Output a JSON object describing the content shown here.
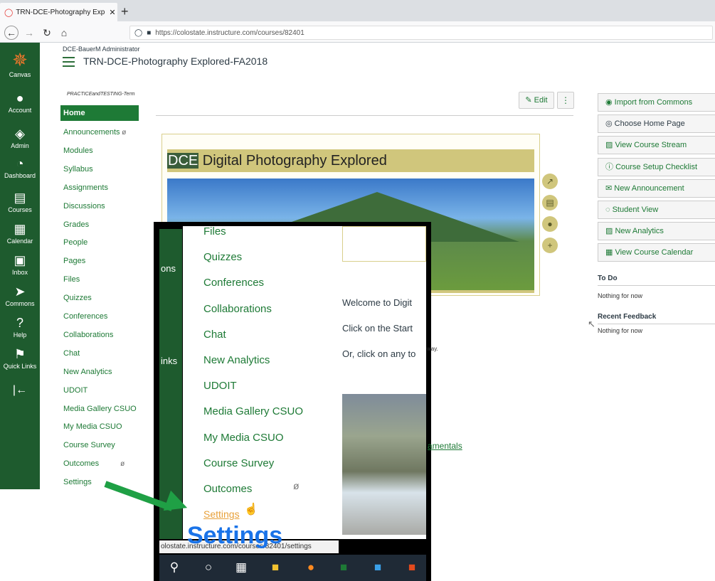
{
  "browser": {
    "tab_title": "TRN-DCE-Photography Exploré",
    "tab_close": "✕",
    "new_tab": "+",
    "url": "https://colostate.instructure.com/courses/82401"
  },
  "global_nav": {
    "items": [
      {
        "label": "Canvas",
        "icon": "canvas-logo-icon"
      },
      {
        "label": "Account",
        "icon": "account-icon"
      },
      {
        "label": "Admin",
        "icon": "admin-icon"
      },
      {
        "label": "Dashboard",
        "icon": "dashboard-icon"
      },
      {
        "label": "Courses",
        "icon": "courses-icon"
      },
      {
        "label": "Calendar",
        "icon": "calendar-icon"
      },
      {
        "label": "Inbox",
        "icon": "inbox-icon"
      },
      {
        "label": "Commons",
        "icon": "commons-icon"
      },
      {
        "label": "Help",
        "icon": "help-icon"
      },
      {
        "label": "Quick Links",
        "icon": "quick-links-icon"
      }
    ],
    "collapse_glyph": "|←"
  },
  "header": {
    "admin_crumb": "DCE-BauerM Administrator",
    "course_title": "TRN-DCE-Photography Explored-FA2018",
    "term": "PRACTICEandTESTING-Term"
  },
  "course_nav": {
    "items": [
      "Home",
      "Announcements",
      "Modules",
      "Syllabus",
      "Assignments",
      "Discussions",
      "Grades",
      "People",
      "Pages",
      "Files",
      "Quizzes",
      "Conferences",
      "Collaborations",
      "Chat",
      "New Analytics",
      "UDOIT",
      "Media Gallery CSUO",
      "My Media CSUO",
      "Course Survey",
      "Outcomes",
      "Settings"
    ]
  },
  "main": {
    "edit_label": "✎ Edit",
    "kebab_label": "⋮",
    "banner_prefix": "DCE",
    "banner_title": " Digital Photography Explored"
  },
  "sidebar": {
    "buttons": [
      "Import from Commons",
      "Choose Home Page",
      "View Course Stream",
      "Course Setup Checklist",
      "New Announcement",
      "Student View",
      "New Analytics",
      "View Course Calendar"
    ],
    "todo_heading": "To Do",
    "todo_text": "Nothing for now",
    "feedback_heading": "Recent Feedback",
    "feedback_text": "Nothing for now"
  },
  "zoom": {
    "global_nav_fragments": [
      "ons",
      "inks"
    ],
    "items": [
      "Files",
      "Quizzes",
      "Conferences",
      "Collaborations",
      "Chat",
      "New Analytics",
      "UDOIT",
      "Media Gallery CSUO",
      "My Media CSUO",
      "Course Survey",
      "Outcomes",
      "Settings"
    ],
    "welcome_1": "Welcome to Digit",
    "welcome_2": "Click on the Start",
    "welcome_3": "Or, click on any to",
    "small_text": "way.",
    "link_text": "amentals",
    "status_url": "olostate.instructure.com/courses/82401/settings",
    "big_label": "Settings"
  }
}
